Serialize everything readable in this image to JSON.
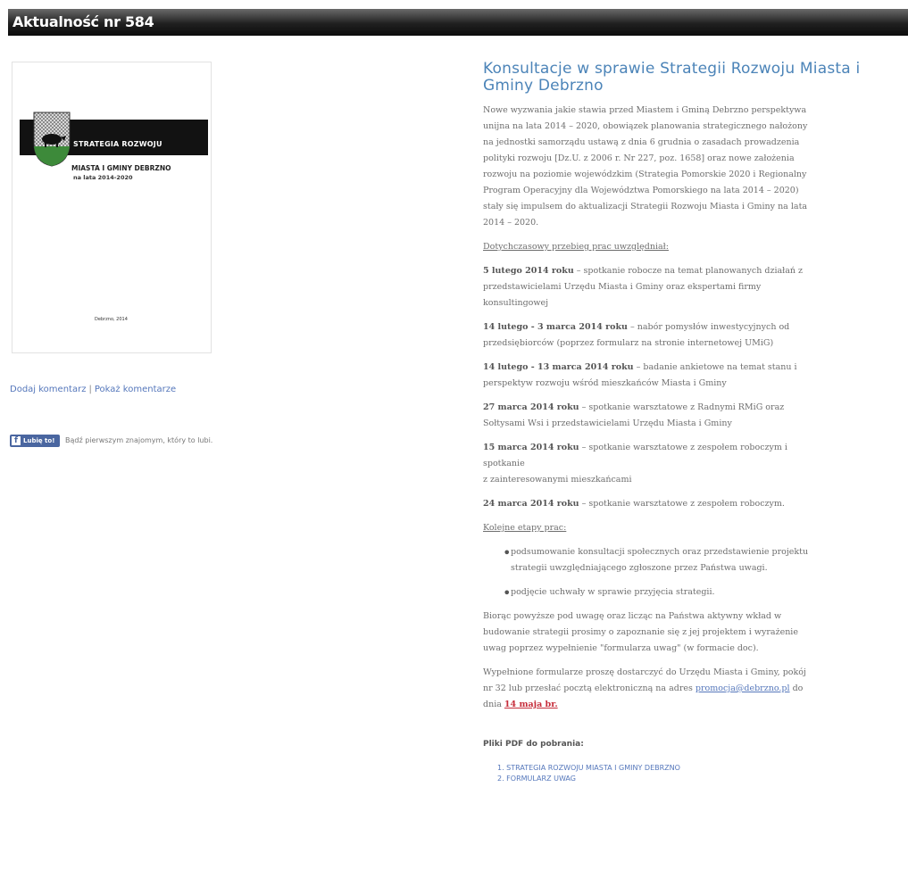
{
  "header": {
    "title": "Aktualność nr 584"
  },
  "cover": {
    "band_text": "STRATEGIA ROZWOJU",
    "line1": "MIASTA I GMINY DEBRZNO",
    "line2": "na lata 2014-2020",
    "footer": "Debrzno, 2014"
  },
  "left_links": {
    "add_comment": "Dodaj komentarz",
    "separator": "|",
    "show_comments": "Pokaż komentarze"
  },
  "like": {
    "button": "Lubię to!",
    "text": "Bądź pierwszym znajomym, który to lubi."
  },
  "article": {
    "title_line1": "Konsultacje w sprawie Strategii Rozwoju Miasta i",
    "title_line2": "Gminy Debrzno",
    "intro": [
      "Nowe wyzwania jakie stawia przed Miastem i Gminą Debrzno perspektywa",
      "unijna na lata 2014 – 2020, obowiązek planowania strategicznego nałożony",
      "na jednostki samorządu ustawą z dnia 6 grudnia o zasadach prowadzenia",
      "polityki rozwoju [Dz.U. z 2006 r. Nr 227, poz. 1658] oraz nowe założenia",
      "rozwoju na poziomie wojewódzkim (Strategia Pomorskie 2020 i Regionalny",
      "Program Operacyjny dla Województwa Pomorskiego na lata 2014 – 2020)",
      "stały się impulsem do aktualizacji Strategii Rozwoju Miasta i Gminy na lata",
      "2014 – 2020."
    ],
    "progress_heading": "Dotychczasowy przebieg prac uwzględniał:",
    "events": [
      {
        "date": "5 lutego 2014 roku",
        "lines": [
          " – spotkanie robocze na temat planowanych działań z",
          "przedstawicielami Urzędu Miasta i Gminy oraz ekspertami firmy",
          "konsultingowej"
        ]
      },
      {
        "date": "14 lutego - 3 marca 2014 roku",
        "lines": [
          " – nabór pomysłów inwestycyjnych od",
          "przedsiębiorców (poprzez formularz na stronie internetowej UMiG)"
        ]
      },
      {
        "date": "14 lutego - 13 marca 2014 roku",
        "lines": [
          " – badanie ankietowe na temat stanu i",
          "perspektyw rozwoju wśród mieszkańców Miasta i Gminy"
        ]
      },
      {
        "date": "27 marca 2014 roku",
        "lines": [
          " – spotkanie warsztatowe z Radnymi RMiG oraz",
          "Sołtysami Wsi i przedstawicielami Urzędu Miasta i Gminy"
        ]
      },
      {
        "date": "15 marca 2014 roku",
        "lines": [
          " – spotkanie warsztatowe z zespołem roboczym i",
          "spotkanie",
          "z zainteresowanymi mieszkańcami"
        ]
      },
      {
        "date": "24 marca 2014 roku",
        "lines": [
          " – spotkanie warsztatowe z zespołem roboczym."
        ]
      }
    ],
    "next_heading": "Kolejne etapy prac:",
    "next_steps": [
      [
        "podsumowanie konsultacji społecznych oraz przedstawienie projektu",
        "strategii uwzględniającego zgłoszone przez Państwa uwagi."
      ],
      [
        "podjęcie uchwały w sprawie przyjęcia strategii."
      ]
    ],
    "closing": [
      "Biorąc powyższe pod uwagę oraz licząc na Państwa aktywny wkład w",
      "budowanie strategii prosimy o zapoznanie się z jej projektem i wyrażenie",
      "uwag poprzez wypełnienie \"formularza uwag\" (w formacie doc)."
    ],
    "submit_line1": "Wypełnione formularze proszę dostarczyć do Urzędu Miasta i Gminy, pokój",
    "submit_line2_pre": "nr 32 lub przesłać pocztą elektroniczną na adres ",
    "email": "promocja@debrzno.pl",
    "submit_line2_post": " do",
    "deadline_pre": "dnia ",
    "deadline": "14 maja br.",
    "pdf_heading": "Pliki PDF do pobrania:",
    "pdf_files": [
      "1. STRATEGIA ROZWOJU MIASTA I GMINY DEBRZNO",
      "2. FORMULARZ UWAG"
    ]
  }
}
